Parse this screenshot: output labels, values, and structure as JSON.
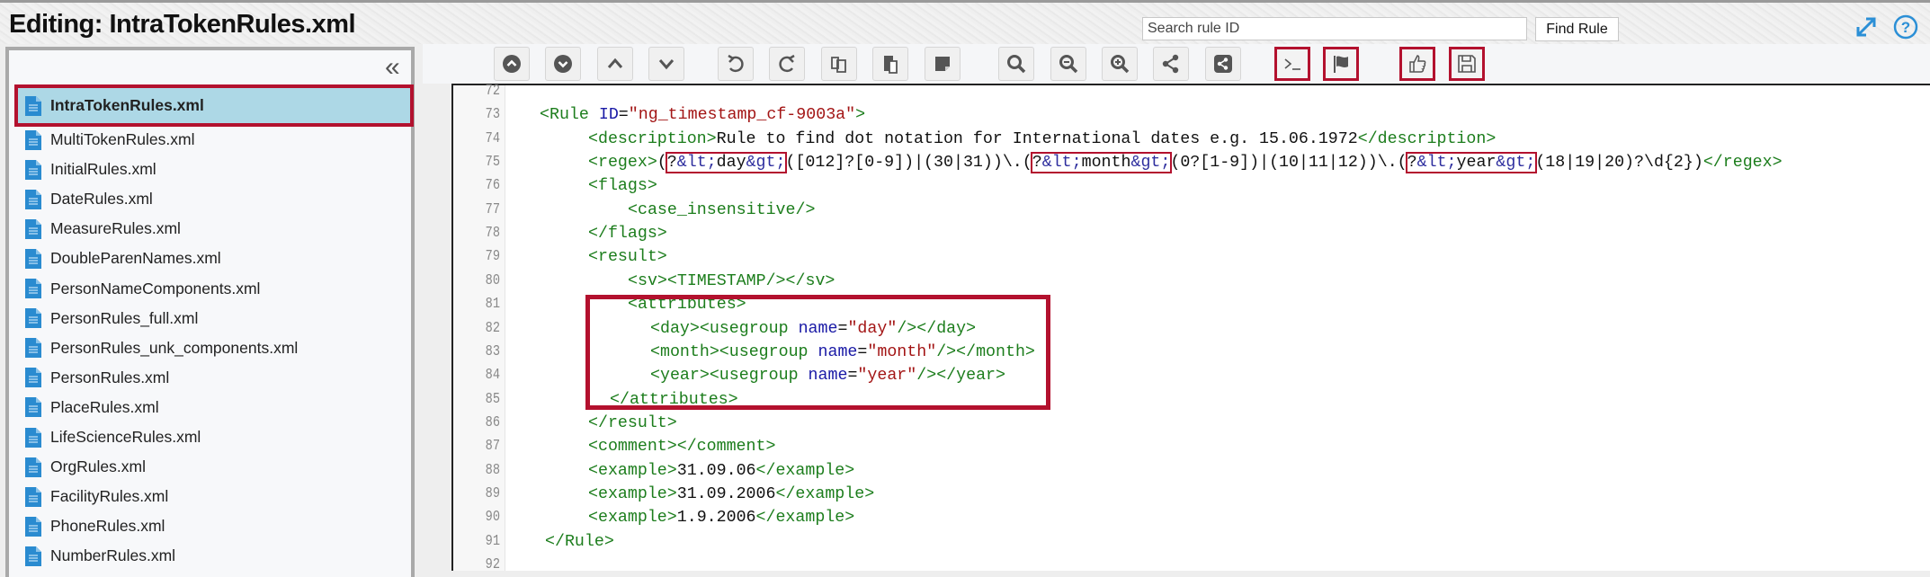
{
  "header": {
    "title": "Editing: IntraTokenRules.xml",
    "search_placeholder": "Search rule ID",
    "find_button": "Find Rule",
    "icons": [
      "expand-icon",
      "help-icon"
    ]
  },
  "sidebar": {
    "collapse_label": "«",
    "selected_index": 0,
    "files": [
      "IntraTokenRules.xml",
      "MultiTokenRules.xml",
      "InitialRules.xml",
      "DateRules.xml",
      "MeasureRules.xml",
      "DoubleParenNames.xml",
      "PersonNameComponents.xml",
      "PersonRules_full.xml",
      "PersonRules_unk_components.xml",
      "PersonRules.xml",
      "PlaceRules.xml",
      "LifeScienceRules.xml",
      "OrgRules.xml",
      "FacilityRules.xml",
      "PhoneRules.xml",
      "NumberRules.xml"
    ]
  },
  "toolbar": {
    "buttons": [
      {
        "icon": "circle-up-icon",
        "highlighted": false
      },
      {
        "icon": "circle-down-icon",
        "highlighted": false
      },
      {
        "icon": "chevron-up-icon",
        "highlighted": false
      },
      {
        "icon": "chevron-down-icon",
        "highlighted": false
      },
      {
        "icon": "undo-icon",
        "highlighted": false
      },
      {
        "icon": "redo-icon",
        "highlighted": false
      },
      {
        "icon": "copy-icon",
        "highlighted": false
      },
      {
        "icon": "paste-icon",
        "highlighted": false
      },
      {
        "icon": "note-icon",
        "highlighted": false
      },
      {
        "icon": "search-icon",
        "highlighted": false
      },
      {
        "icon": "zoom-out-icon",
        "highlighted": false
      },
      {
        "icon": "zoom-in-icon",
        "highlighted": false
      },
      {
        "icon": "share-icon",
        "highlighted": false
      },
      {
        "icon": "share-square-icon",
        "highlighted": false
      },
      {
        "icon": "terminal-icon",
        "highlighted": true
      },
      {
        "icon": "flag-icon",
        "highlighted": true
      },
      {
        "icon": "thumbs-up-icon",
        "highlighted": true
      },
      {
        "icon": "save-icon",
        "highlighted": true
      }
    ]
  },
  "colors": {
    "tag": "#1c7d1c",
    "attr": "#1a1aa6",
    "value": "#a31515",
    "entity": "#2e2e9e",
    "highlight": "#b3112e",
    "selected_row": "#add8e6"
  },
  "editor": {
    "lines": [
      {
        "n": "72",
        "s": []
      },
      {
        "n": "73",
        "s": [
          [
            "t",
            "<Rule"
          ],
          [
            "x",
            " "
          ],
          [
            "a",
            "ID"
          ],
          [
            "x",
            "="
          ],
          [
            "v",
            "\"ng_timestamp_cf-9003a\""
          ],
          [
            "t",
            ">"
          ]
        ]
      },
      {
        "n": "74",
        "s": [
          [
            "t",
            "<description>"
          ],
          [
            "x",
            "Rule to find dot notation for International dates e.g. 15.06.1972"
          ],
          [
            "t",
            "</description>"
          ]
        ]
      },
      {
        "n": "75",
        "s": [
          [
            "t",
            "<regex>"
          ],
          [
            "x",
            "("
          ],
          [
            "box",
            [
              [
                "x",
                "?"
              ],
              [
                "e",
                "&lt;"
              ],
              [
                "x",
                "day"
              ],
              [
                "e",
                "&gt;"
              ]
            ]
          ],
          [
            "x",
            "([012]?[0-9])|(30|31))\\.("
          ],
          [
            "box",
            [
              [
                "x",
                "?"
              ],
              [
                "e",
                "&lt;"
              ],
              [
                "x",
                "month"
              ],
              [
                "e",
                "&gt;"
              ]
            ]
          ],
          [
            "x",
            "(0?[1-9])|(10|11|12))\\.("
          ],
          [
            "box",
            [
              [
                "x",
                "?"
              ],
              [
                "e",
                "&lt;"
              ],
              [
                "x",
                "year"
              ],
              [
                "e",
                "&gt;"
              ]
            ]
          ],
          [
            "x",
            "(18|19|20)?\\d{2})"
          ],
          [
            "t",
            "</regex>"
          ]
        ]
      },
      {
        "n": "76",
        "s": [
          [
            "t",
            "<flags>"
          ]
        ]
      },
      {
        "n": "77",
        "s": [
          [
            "t",
            "<case_insensitive/>"
          ]
        ]
      },
      {
        "n": "78",
        "s": [
          [
            "t",
            "</flags>"
          ]
        ]
      },
      {
        "n": "79",
        "s": [
          [
            "t",
            "<result>"
          ]
        ]
      },
      {
        "n": "80",
        "s": [
          [
            "t",
            "<sv><TIMESTAMP/></sv>"
          ]
        ]
      },
      {
        "n": "81",
        "s": [
          [
            "t",
            "<attributes>"
          ]
        ]
      },
      {
        "n": "82",
        "s": [
          [
            "t",
            "<day><usegroup"
          ],
          [
            "x",
            " "
          ],
          [
            "a",
            "name"
          ],
          [
            "x",
            "="
          ],
          [
            "v",
            "\"day\""
          ],
          [
            "t",
            "/></day>"
          ]
        ]
      },
      {
        "n": "83",
        "s": [
          [
            "t",
            "<month><usegroup"
          ],
          [
            "x",
            " "
          ],
          [
            "a",
            "name"
          ],
          [
            "x",
            "="
          ],
          [
            "v",
            "\"month\""
          ],
          [
            "t",
            "/></month>"
          ]
        ]
      },
      {
        "n": "84",
        "s": [
          [
            "t",
            "<year><usegroup"
          ],
          [
            "x",
            " "
          ],
          [
            "a",
            "name"
          ],
          [
            "x",
            "="
          ],
          [
            "v",
            "\"year\""
          ],
          [
            "t",
            "/></year>"
          ]
        ]
      },
      {
        "n": "85",
        "s": [
          [
            "t",
            "</attributes>"
          ]
        ]
      },
      {
        "n": "86",
        "s": [
          [
            "t",
            "</result>"
          ]
        ]
      },
      {
        "n": "87",
        "s": [
          [
            "t",
            "<comment></comment>"
          ]
        ]
      },
      {
        "n": "88",
        "s": [
          [
            "t",
            "<example>"
          ],
          [
            "x",
            "31.09.06"
          ],
          [
            "t",
            "</example>"
          ]
        ]
      },
      {
        "n": "89",
        "s": [
          [
            "t",
            "<example>"
          ],
          [
            "x",
            "31.09.2006"
          ],
          [
            "t",
            "</example>"
          ]
        ]
      },
      {
        "n": "90",
        "s": [
          [
            "t",
            "<example>"
          ],
          [
            "x",
            "1.9.2006"
          ],
          [
            "t",
            "</example>"
          ]
        ]
      },
      {
        "n": "91",
        "s": [
          [
            "t",
            "</Rule>"
          ]
        ]
      },
      {
        "n": "92",
        "s": []
      }
    ]
  }
}
